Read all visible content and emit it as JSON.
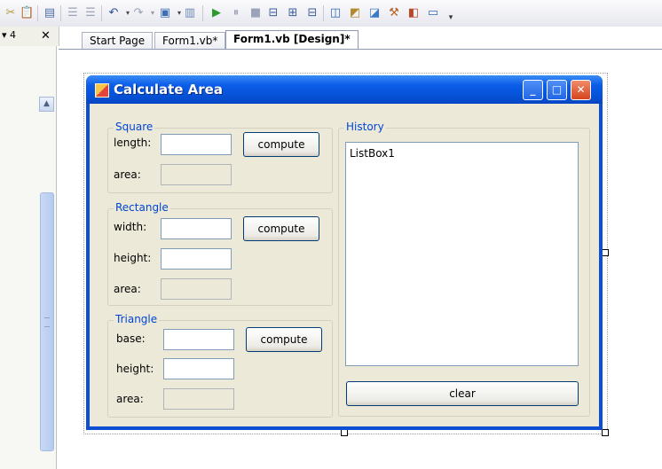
{
  "toolbar": {
    "icons": [
      "cut-icon",
      "paste-icon",
      "print-icon",
      "indent-icon",
      "outdent-icon",
      "undo-icon",
      "redo-icon",
      "add-item-icon",
      "navigate-icon",
      "start-icon",
      "pause-icon",
      "stop-icon",
      "find-icon",
      "bookmark-icon",
      "comment-icon",
      "solution-explorer-icon",
      "properties-icon",
      "object-browser-icon",
      "toolbox-icon",
      "class-view-icon",
      "window-icon",
      "overflow-icon"
    ]
  },
  "side_panel": {
    "pin_glyph": "▾ 4",
    "close_glyph": "✕"
  },
  "tabs": [
    {
      "label": "Start Page"
    },
    {
      "label": "Form1.vb*"
    },
    {
      "label": "Form1.vb [Design]*"
    }
  ],
  "form": {
    "title": "Calculate Area",
    "square": {
      "legend": "Square",
      "length_label": "length:",
      "area_label": "area:",
      "compute_label": "compute"
    },
    "rectangle": {
      "legend": "Rectangle",
      "width_label": "width:",
      "height_label": "height:",
      "area_label": "area:",
      "compute_label": "compute"
    },
    "triangle": {
      "legend": "Triangle",
      "base_label": "base:",
      "height_label": "height:",
      "area_label": "area:",
      "compute_label": "compute"
    },
    "history": {
      "legend": "History",
      "listbox_text": "ListBox1",
      "clear_label": "clear"
    }
  },
  "colors": {
    "titlebar": "#0652d9",
    "client": "#ece9d8",
    "legend_text": "#0046d5"
  }
}
